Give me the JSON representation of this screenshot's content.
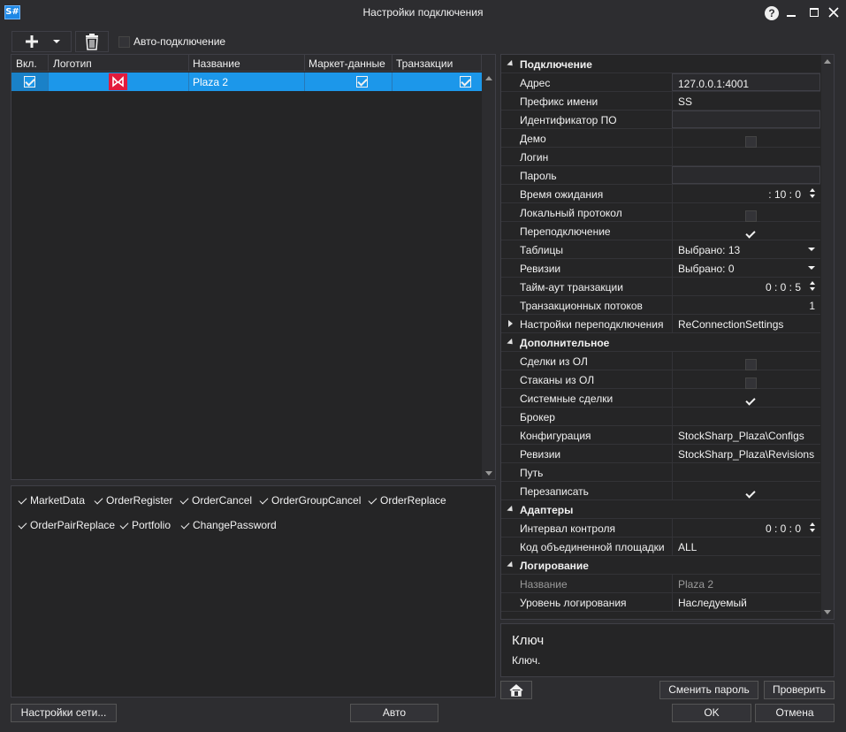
{
  "window": {
    "app_icon_text": "S#",
    "title": "Настройки подключения"
  },
  "toolbar": {
    "auto_connect_label": "Авто-подключение"
  },
  "grid": {
    "headers": [
      "Вкл.",
      "Логотип",
      "Название",
      "Маркет-данные",
      "Транзакции"
    ],
    "rows": [
      {
        "name": "Plaza 2",
        "enabled": true,
        "market_data": true,
        "transactions": true
      }
    ]
  },
  "messages": [
    "MarketData",
    "OrderRegister",
    "OrderCancel",
    "OrderGroupCancel",
    "OrderReplace",
    "OrderPairReplace",
    "Portfolio",
    "ChangePassword"
  ],
  "props": {
    "cat_connection": "Подключение",
    "address_label": "Адрес",
    "address_value": "127.0.0.1:4001",
    "prefix_label": "Префикс имени",
    "prefix_value": "SS",
    "appid_label": "Идентификатор ПО",
    "demo_label": "Демо",
    "login_label": "Логин",
    "password_label": "Пароль",
    "timeout_label": "Время ожидания",
    "timeout_value": ": 10 : 0",
    "local_label": "Локальный протокол",
    "reconnect_label": "Переподключение",
    "tables_label": "Таблицы",
    "tables_value": "Выбрано: 13",
    "revisions_label": "Ревизии",
    "revisions_value": "Выбрано: 0",
    "tx_timeout_label": "Тайм-аут транзакции",
    "tx_timeout_value": "0 : 0 : 5",
    "tx_threads_label": "Транзакционных потоков",
    "tx_threads_value": "1",
    "reconn_settings_label": "Настройки переподключения",
    "reconn_settings_value": "ReConnectionSettings",
    "cat_additional": "Дополнительное",
    "ol_trades_label": "Сделки из ОЛ",
    "ol_books_label": "Стаканы из ОЛ",
    "sys_trades_label": "Системные сделки",
    "broker_label": "Брокер",
    "config_label": "Конфигурация",
    "config_value": "StockSharp_Plaza\\Configs",
    "revisions2_label": "Ревизии",
    "revisions2_value": "StockSharp_Plaza\\Revisions",
    "path_label": "Путь",
    "overwrite_label": "Перезаписать",
    "cat_adapters": "Адаптеры",
    "interval_label": "Интервал контроля",
    "interval_value": "0 : 0 : 0",
    "unified_label": "Код объединенной площадки",
    "unified_value": "ALL",
    "cat_logging": "Логирование",
    "name_label": "Название",
    "name_value": "Plaza 2",
    "loglevel_label": "Уровень логирования",
    "loglevel_value": "Наследуемый"
  },
  "description": {
    "title": "Ключ",
    "text": "Ключ."
  },
  "buttons": {
    "change_password": "Сменить пароль",
    "check": "Проверить",
    "network": "Настройки сети...",
    "auto": "Авто",
    "ok": "OK",
    "cancel": "Отмена"
  },
  "colors": {
    "selection": "#1c97ea",
    "logo": "#e31b3c",
    "background": "#2d2d30"
  }
}
